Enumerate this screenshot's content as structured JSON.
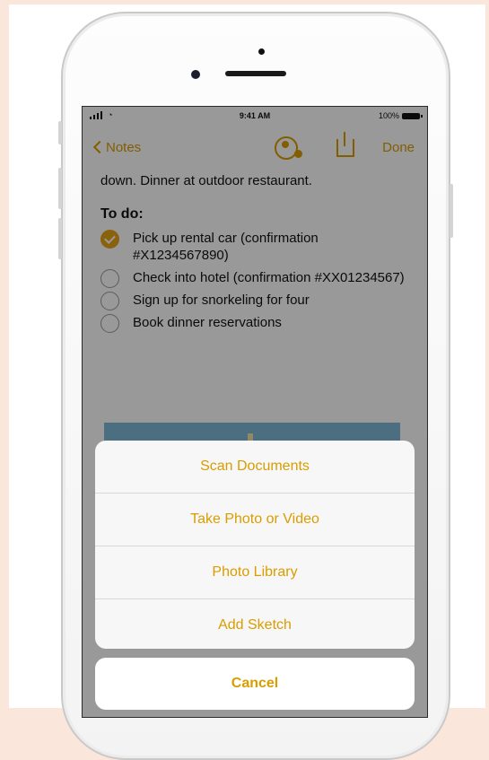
{
  "status": {
    "time": "9:41 AM",
    "battery": "100%"
  },
  "nav": {
    "back_label": "Notes",
    "done_label": "Done"
  },
  "note": {
    "line": "down. Dinner at outdoor restaurant.",
    "todo_heading": "To do:",
    "items": [
      {
        "text": "Pick up rental car (confirmation #X1234567890)",
        "checked": true
      },
      {
        "text": "Check into hotel (confirmation #XX01234567)",
        "checked": false
      },
      {
        "text": "Sign up for snorkeling for four",
        "checked": false
      },
      {
        "text": "Book dinner reservations",
        "checked": false
      }
    ]
  },
  "action_sheet": {
    "actions": [
      "Scan Documents",
      "Take Photo or Video",
      "Photo Library",
      "Add Sketch"
    ],
    "cancel": "Cancel"
  },
  "colors": {
    "accent": "#d99d00",
    "check": "#e6a317",
    "background": "#fbe6dc"
  },
  "icons": [
    "signal-icon",
    "wifi-icon",
    "battery-icon",
    "back-chevron-icon",
    "add-people-icon",
    "share-icon",
    "checkbox-icon"
  ]
}
